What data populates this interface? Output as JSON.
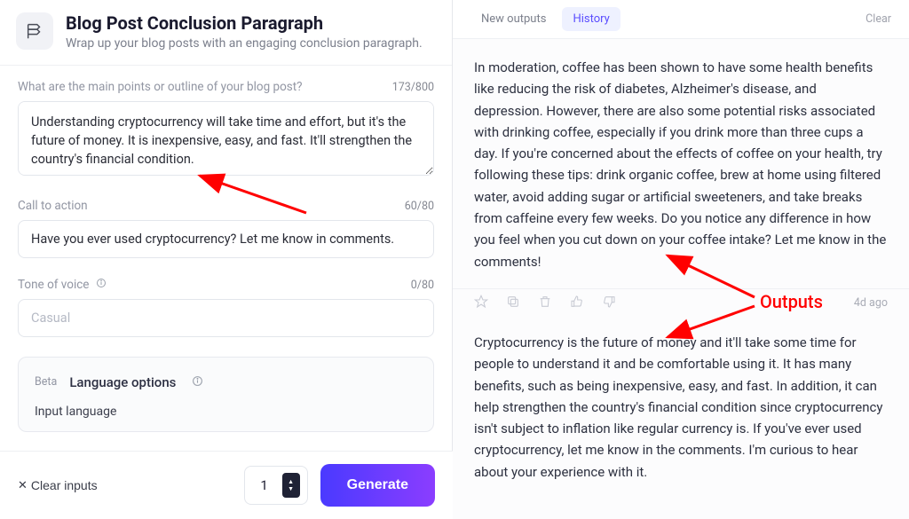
{
  "header": {
    "title": "Blog Post Conclusion Paragraph",
    "subtitle": "Wrap up your blog posts with an engaging conclusion paragraph."
  },
  "fields": {
    "main_points": {
      "label": "What are the main points or outline of your blog post?",
      "counter": "173/800",
      "value": "Understanding cryptocurrency will take time and effort, but it's the future of money. It is inexpensive, easy, and fast. It'll strengthen the country's financial condition."
    },
    "cta": {
      "label": "Call to action",
      "counter": "60/80",
      "value": "Have you ever used cryptocurrency? Let me know in comments."
    },
    "tone": {
      "label": "Tone of voice",
      "counter": "0/80",
      "placeholder": "Casual",
      "value": ""
    }
  },
  "language": {
    "beta": "Beta",
    "title": "Language options",
    "input_label": "Input language"
  },
  "actions": {
    "clear_inputs": "Clear inputs",
    "quantity": "1",
    "generate": "Generate"
  },
  "tabs": {
    "new_outputs": "New outputs",
    "history": "History",
    "clear": "Clear"
  },
  "outputs": [
    {
      "text": "In moderation, coffee has been shown to have some health benefits like reducing the risk of diabetes, Alzheimer's disease, and depression. However, there are also some potential risks associated with drinking coffee, especially if you drink more than three cups a day. If you're concerned about the effects of coffee on your health, try following these tips: drink organic coffee, brew at home using filtered water, avoid adding sugar or artificial sweeteners, and take breaks from caffeine every few weeks. Do you notice any difference in how you feel when you cut down on your coffee intake? Let me know in the comments!"
    },
    {
      "text": "Cryptocurrency is the future of money and it'll take some time for people to understand it and be comfortable using it. It has many benefits, such as being inexpensive, easy, and fast. In addition, it can help strengthen the country's financial condition since cryptocurrency isn't subject to inflation like regular currency is. If you've ever used cryptocurrency, let me know in the comments. I'm curious to hear about your experience with it."
    }
  ],
  "output_meta": {
    "timestamp": "4d ago"
  },
  "annotations": {
    "outputs_label": "Outputs"
  }
}
